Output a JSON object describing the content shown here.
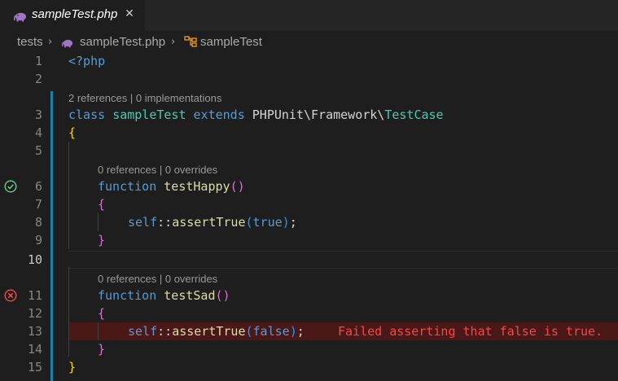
{
  "tab": {
    "title": "sampleTest.php",
    "close": "✕"
  },
  "breadcrumb": {
    "folder": "tests",
    "file": "sampleTest.php",
    "symbol": "sampleTest",
    "sep": "›"
  },
  "lines": [
    {
      "n": "1",
      "code": "<?php"
    },
    {
      "n": "2",
      "code": ""
    },
    {
      "lens": "2 references | 0 implementations"
    },
    {
      "n": "3",
      "kw1": "class",
      "cls1": "sampleTest",
      "kw2": "extends",
      "ns": "PHPUnit\\Framework\\",
      "cls2": "TestCase"
    },
    {
      "n": "4",
      "code": "{"
    },
    {
      "n": "5",
      "code": ""
    },
    {
      "lens": "0 references | 0 overrides"
    },
    {
      "n": "6",
      "kw": "function",
      "fn": "testHappy",
      "paren": "()",
      "status": "pass"
    },
    {
      "n": "7",
      "code": "{"
    },
    {
      "n": "8",
      "self": "self",
      "op": "::",
      "fn": "assertTrue",
      "arg": "true",
      "tail": ";"
    },
    {
      "n": "9",
      "code": "}"
    },
    {
      "n": "10",
      "code": ""
    },
    {
      "lens": "0 references | 0 overrides"
    },
    {
      "n": "11",
      "kw": "function",
      "fn": "testSad",
      "paren": "()",
      "status": "fail"
    },
    {
      "n": "12",
      "code": "{"
    },
    {
      "n": "13",
      "self": "self",
      "op": "::",
      "fn": "assertTrue",
      "arg": "false",
      "tail": ";",
      "error": "Failed asserting that false is true."
    },
    {
      "n": "14",
      "code": "}"
    },
    {
      "n": "15",
      "code": "}"
    }
  ],
  "colors": {
    "background": "#1e1e1e",
    "keyword": "#569cd6",
    "class": "#4ec9b0",
    "function": "#dcdcaa",
    "error": "#f44747",
    "pass": "#73c991"
  }
}
